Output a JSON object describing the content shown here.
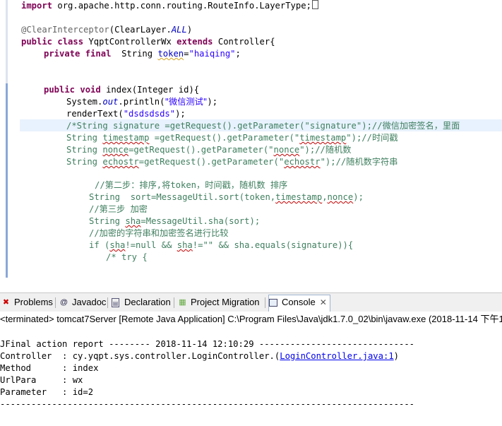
{
  "editor": {
    "lines": {
      "l1_kw": "import",
      "l1_rest": " org.apache.http.conn.routing.RouteInfo.LayerType;",
      "l3_ann": "@ClearInterceptor",
      "l3_rest1": "(ClearLayer.",
      "l3_all": "ALL",
      "l3_rest2": ")",
      "l4_kw1": "public",
      "l4_kw2": "class",
      "l4_name": " YqptControllerWx ",
      "l4_kw3": "extends",
      "l4_rest": " Controller{",
      "l5_kw1": "private",
      "l5_kw2": "final",
      "l5_type": "  String ",
      "l5_field": "token",
      "l5_eq": "=",
      "l5_str": "\"haiqing\"",
      "l5_end": ";",
      "l8_kw1": "public",
      "l8_kw2": "void",
      "l8_rest": " index(Integer id){",
      "l9_a": "System.",
      "l9_out": "out",
      "l9_b": ".println(",
      "l9_str": "\"微信测试\"",
      "l9_c": ");",
      "l10_a": "renderText(",
      "l10_str": "\"dsdsdsds\"",
      "l10_b": ");",
      "l11": "/*String signature =getRequest().getParameter(\"signature\");//微信加密签名，里面",
      "l12_a": "String ",
      "l12_sq": "timestamp",
      "l12_b": " =getRequest().getParameter(\"",
      "l12_sq2": "timestamp",
      "l12_c": "\");//时间戳",
      "l13_a": "String ",
      "l13_sq": "nonce",
      "l13_b": "=getRequest().getParameter(\"",
      "l13_sq2": "nonce",
      "l13_c": "\");//随机数",
      "l14_a": "String ",
      "l14_sq": "echostr",
      "l14_b": "=getRequest().getParameter(\"",
      "l14_sq2": "echostr",
      "l14_c": "\");//随机数字符串",
      "l16": "//第二步：排序,将token，时间戳，随机数 排序",
      "l17_a": "String  sort=MessageUtil.sort(token,",
      "l17_sq": "timestamp",
      "l17_b": ",",
      "l17_sq2": "nonce",
      "l17_c": ");",
      "l18": "//第三步 加密",
      "l19_a": "String ",
      "l19_sq": "sha",
      "l19_b": "=MessageUtil.sha(sort);",
      "l20": "//加密的字符串和加密签名进行比较",
      "l21_a": "if (",
      "l21_sq": "sha",
      "l21_b": "!=null && ",
      "l21_sq2": "sha",
      "l21_c": "!=\"\" && sha.equals(signature)){",
      "l22": "/* try {"
    }
  },
  "tabs": [
    {
      "label": "Problems",
      "icon": "problems-icon"
    },
    {
      "label": "Javadoc",
      "icon": "javadoc-icon"
    },
    {
      "label": "Declaration",
      "icon": "declaration-icon"
    },
    {
      "label": "Project Migration",
      "icon": "project-migration-icon"
    },
    {
      "label": "Console",
      "icon": "console-icon"
    }
  ],
  "console": {
    "terminated": "<terminated> tomcat7Server [Remote Java Application] C:\\Program Files\\Java\\jdk1.7.0_02\\bin\\javaw.exe (2018-11-14 下午1",
    "report_title": "JFinal action report -------- 2018-11-14 12:10:29 ------------------------------",
    "controller_label": "Controller  : cy.yqpt.sys.controller.LoginController.(",
    "controller_link": "LoginController.java:1",
    "controller_end": ")",
    "method": "Method      : index",
    "urlpara": "UrlPara     : wx",
    "parameter": "Parameter   : id=2",
    "divider": "--------------------------------------------------------------------------------"
  },
  "colors": {
    "keyword": "#7f0055",
    "string": "#2a00ff",
    "comment": "#3f7f5f",
    "field": "#0000c0",
    "highlight": "#e8f2fe"
  }
}
